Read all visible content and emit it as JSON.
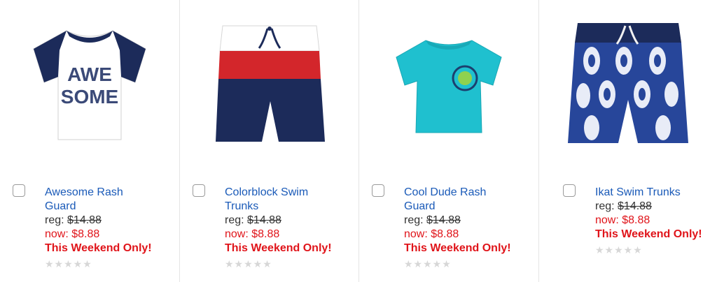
{
  "products": [
    {
      "name": "Awesome Rash Guard",
      "reg_label": "reg: ",
      "reg_price": "$14.88",
      "now_label": "now: ",
      "now_price": "$8.88",
      "promo": "This Weekend Only!",
      "rating_stars": 0,
      "image_icon": "rash-guard-awesome-icon",
      "colors": {
        "primary": "#1c2b5a",
        "body": "#ffffff"
      }
    },
    {
      "name": "Colorblock Swim Trunks",
      "reg_label": "reg: ",
      "reg_price": "$14.88",
      "now_label": "now: ",
      "now_price": "$8.88",
      "promo": "This Weekend Only!",
      "rating_stars": 0,
      "image_icon": "swim-trunks-colorblock-icon",
      "colors": {
        "top": "#ffffff",
        "middle": "#d3262b",
        "bottom": "#1c2b5a"
      }
    },
    {
      "name": "Cool Dude Rash Guard",
      "reg_label": "reg: ",
      "reg_price": "$14.88",
      "now_label": "now: ",
      "now_price": "$8.88",
      "promo": "This Weekend Only!",
      "rating_stars": 0,
      "image_icon": "rash-guard-cool-dude-icon",
      "colors": {
        "body": "#1fc0cf"
      }
    },
    {
      "name": "Ikat Swim Trunks",
      "reg_label": "reg: ",
      "reg_price": "$14.88",
      "now_label": "now: ",
      "now_price": "$8.88",
      "promo": "This Weekend Only!",
      "rating_stars": 0,
      "image_icon": "swim-trunks-ikat-icon",
      "colors": {
        "primary": "#27469a",
        "secondary": "#e8ecf7"
      }
    }
  ],
  "rating_glyphs": "★★★★★",
  "image_text": {
    "awesome_line1": "AWE",
    "awesome_line2": "SOME"
  },
  "theme": {
    "link": "#1a5ab8",
    "sale": "#e0141a",
    "star_off": "#d7d7d7"
  }
}
